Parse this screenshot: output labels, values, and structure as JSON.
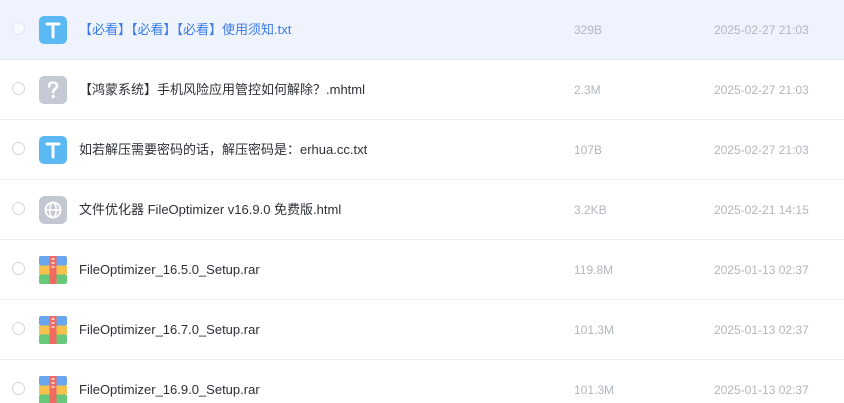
{
  "files": [
    {
      "name": "【必看】【必看】【必看】使用须知.txt",
      "size": "329B",
      "date": "2025-02-27 21:03",
      "icon": "txt-file-icon",
      "selected": true
    },
    {
      "name": "【鸿蒙系统】手机风险应用管控如何解除？.mhtml",
      "size": "2.3M",
      "date": "2025-02-27 21:03",
      "icon": "unknown-file-icon",
      "selected": false
    },
    {
      "name": "如若解压需要密码的话，解压密码是：erhua.cc.txt",
      "size": "107B",
      "date": "2025-02-27 21:03",
      "icon": "txt-file-icon",
      "selected": false
    },
    {
      "name": "文件优化器 FileOptimizer v16.9.0 免费版.html",
      "size": "3.2KB",
      "date": "2025-02-21 14:15",
      "icon": "html-globe-icon",
      "selected": false
    },
    {
      "name": "FileOptimizer_16.5.0_Setup.rar",
      "size": "119.8M",
      "date": "2025-01-13 02:37",
      "icon": "rar-archive-icon",
      "selected": false
    },
    {
      "name": "FileOptimizer_16.7.0_Setup.rar",
      "size": "101.3M",
      "date": "2025-01-13 02:37",
      "icon": "rar-archive-icon",
      "selected": false
    },
    {
      "name": "FileOptimizer_16.9.0_Setup.rar",
      "size": "101.3M",
      "date": "2025-01-13 02:37",
      "icon": "rar-archive-icon",
      "selected": false
    }
  ],
  "colors": {
    "selected_row_bg": "#eef3fe",
    "selected_text": "#3a7be8",
    "txt_icon": "#5ab8f3",
    "unknown_icon": "#c4c9d3",
    "globe_icon": "#c2c7d2"
  }
}
